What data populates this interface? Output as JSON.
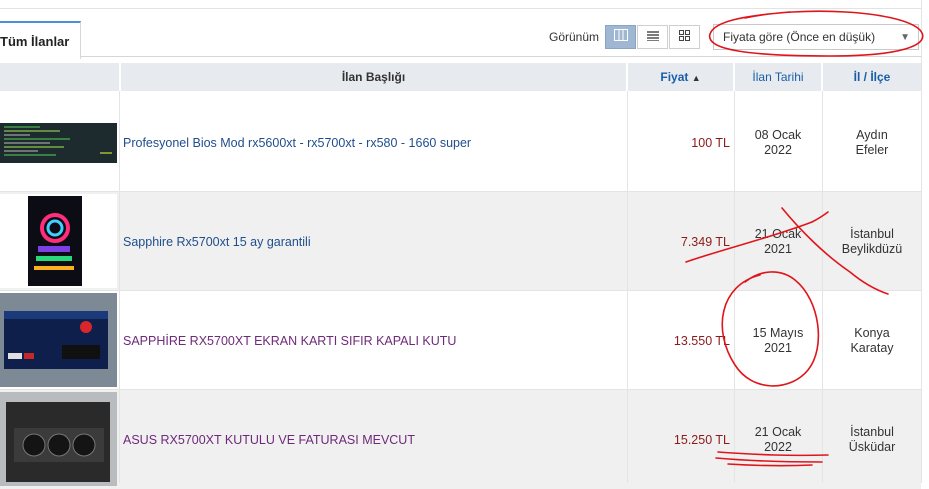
{
  "tabs": {
    "all_listings": "Tüm İlanlar"
  },
  "toolbar": {
    "view_label": "Görünüm",
    "view_modes": [
      "list-table-icon",
      "list-icon",
      "grid-icon"
    ],
    "active_view": "list-table-icon",
    "sort": {
      "selected": "Fiyata göre (Önce en düşük)"
    }
  },
  "table": {
    "headers": {
      "title": "İlan Başlığı",
      "price": "Fiyat",
      "price_sort": "▲",
      "date": "İlan Tarihi",
      "city": "İl / İlçe"
    },
    "rows": [
      {
        "title": "Profesyonel Bios Mod rx5600xt - rx5700xt - rx580 - 1660 super",
        "price": "100 TL",
        "date_line1": "08 Ocak",
        "date_line2": "2022",
        "city_line1": "Aydın",
        "city_line2": "Efeler",
        "visited": false
      },
      {
        "title": "Sapphire Rx5700xt 15 ay garantili",
        "price": "7.349 TL",
        "date_line1": "21 Ocak",
        "date_line2": "2021",
        "city_line1": "İstanbul",
        "city_line2": "Beylikdüzü",
        "visited": false
      },
      {
        "title": "SAPPHİRE RX5700XT EKRAN KARTI SIFIR KAPALI KUTU",
        "price": "13.550 TL",
        "date_line1": "15 Mayıs",
        "date_line2": "2021",
        "city_line1": "Konya",
        "city_line2": "Karatay",
        "visited": true
      },
      {
        "title": "ASUS RX5700XT KUTULU VE FATURASI MEVCUT",
        "price": "15.250 TL",
        "date_line1": "21 Ocak",
        "date_line2": "2022",
        "city_line1": "İstanbul",
        "city_line2": "Üsküdar",
        "visited": true
      }
    ]
  },
  "colors": {
    "accent": "#1a5ea8",
    "price": "#8b1a1a",
    "visited_link": "#6e2a7a",
    "annotation": "#e0151b"
  }
}
